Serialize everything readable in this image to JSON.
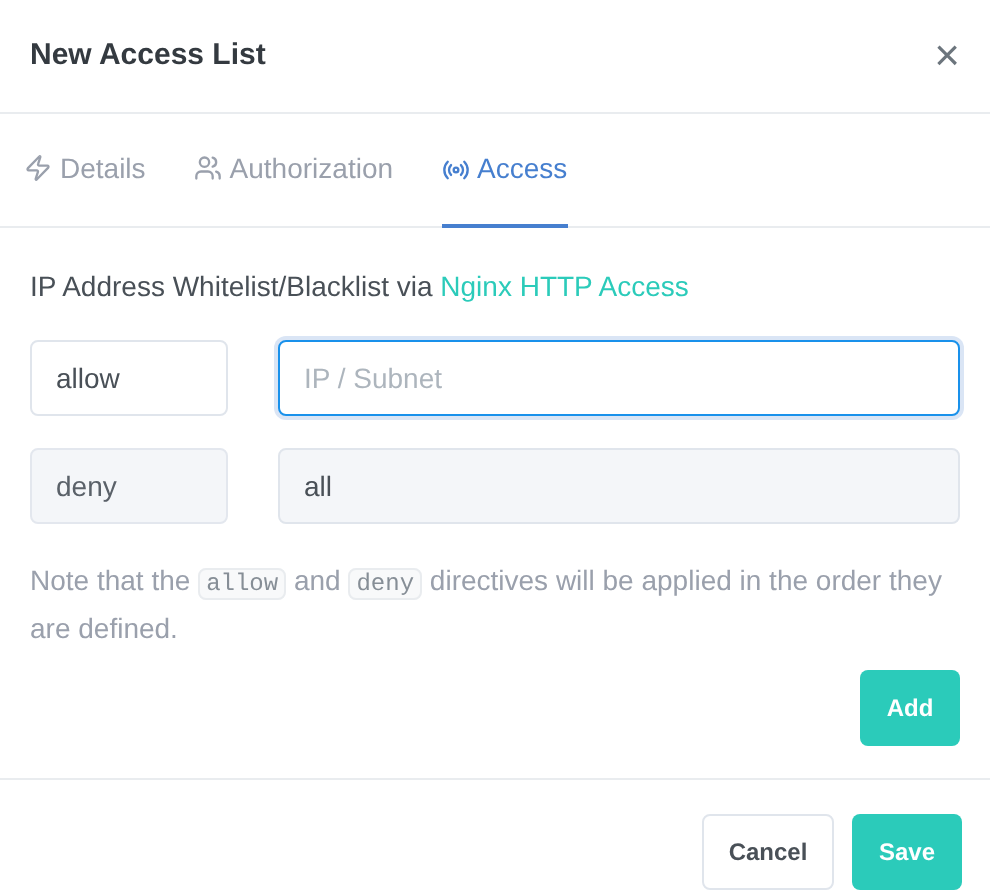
{
  "dialog": {
    "title": "New Access List",
    "close": "×"
  },
  "tabs": [
    {
      "label": "Details",
      "selected": false
    },
    {
      "label": "Authorization",
      "selected": false
    },
    {
      "label": "Access",
      "selected": true
    }
  ],
  "intro": {
    "text": "IP Address Whitelist/Blacklist via ",
    "link": "Nginx HTTP Access"
  },
  "rules": [
    {
      "directive": "allow",
      "address": {
        "placeholder": "IP / Subnet",
        "focused": true
      },
      "disabled": false
    },
    {
      "directive": "deny",
      "address": {
        "value": "all",
        "focused": false
      },
      "disabled": true
    }
  ],
  "note": [
    {
      "kind": "text",
      "text": "Note that the "
    },
    {
      "kind": "code",
      "text": "allow"
    },
    {
      "kind": "text",
      "text": " and "
    },
    {
      "kind": "code",
      "text": "deny"
    },
    {
      "kind": "text",
      "text": " directives will be applied in the order they are defined."
    }
  ],
  "add_button": "Add",
  "footer": {
    "cancel": "Cancel",
    "save": "Save"
  }
}
